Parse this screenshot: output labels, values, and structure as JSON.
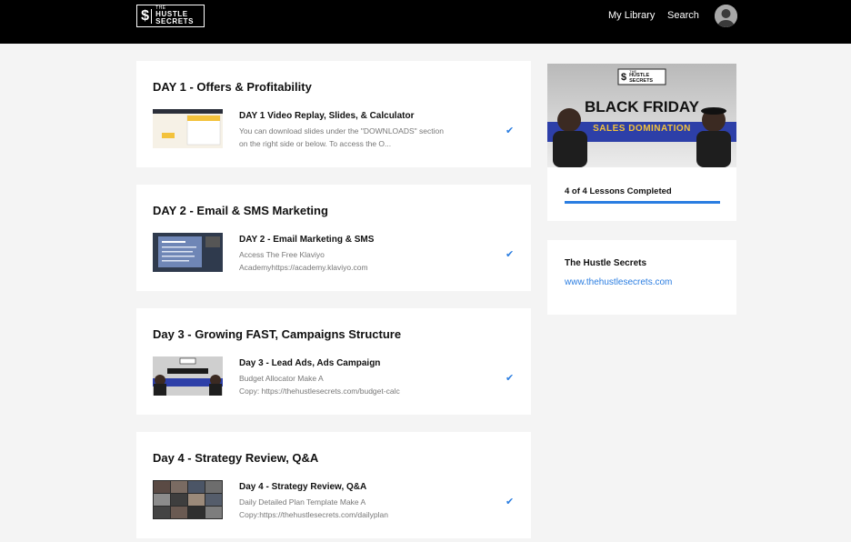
{
  "header": {
    "logo_small": "THE",
    "logo_big": "HUSTLE SECRETS",
    "nav": {
      "library": "My Library",
      "search": "Search"
    }
  },
  "days": [
    {
      "title": "DAY 1 - Offers & Profitability",
      "lesson_title": "DAY 1 Video Replay, Slides, & Calculator",
      "line1": "You can download slides under the \"DOWNLOADS\" section",
      "line2": "on the right side or below. To access the O...",
      "thumb_text_a": "2 MAIN",
      "thumb_text_b": "OFFER OPTIONS",
      "thumb_text_c": "Discounts Gift",
      "thumb_text_d": "Buy X Get Y Bob",
      "thumb_text_e": "Take Save Offer"
    },
    {
      "title": "DAY 2 - Email & SMS Marketing",
      "lesson_title": "DAY 2 - Email Marketing & SMS",
      "line1": "Access The Free Klaviyo",
      "line2": "Academyhttps://academy.klaviyo.com",
      "thumb_text_a": "EMAIL&SMS"
    },
    {
      "title": "Day 3 - Growing FAST, Campaigns Structure",
      "lesson_title": "Day 3 - Lead Ads, Ads Campaign",
      "line1": "Budget Allocator Make A",
      "line2": "Copy: https://thehustlesecrets.com/budget-calc",
      "thumb_text_a": "BLACK FRIDAY",
      "thumb_text_b": "SALES DOMINATION"
    },
    {
      "title": "Day 4 - Strategy Review, Q&A",
      "lesson_title": "Day 4 - Strategy Review, Q&A",
      "line1": "Daily Detailed Plan Template Make A",
      "line2": "Copy:https://thehustlesecrets.com/dailyplan"
    }
  ],
  "promo": {
    "logo_small": "THE",
    "logo_big": "HUSTLE SECRETS",
    "headline": "BLACK FRIDAY",
    "banner": "SALES DOMINATION",
    "progress_text": "4 of 4 Lessons Completed",
    "progress_fraction": 1.0
  },
  "info": {
    "title": "The Hustle Secrets",
    "link": "www.thehustlesecrets.com"
  },
  "colors": {
    "accent": "#2a7de1",
    "header_bg": "#000000",
    "page_bg": "#f4f4f4"
  },
  "icons": {
    "check": "check-icon",
    "avatar": "avatar-icon",
    "logo": "logo-icon"
  }
}
